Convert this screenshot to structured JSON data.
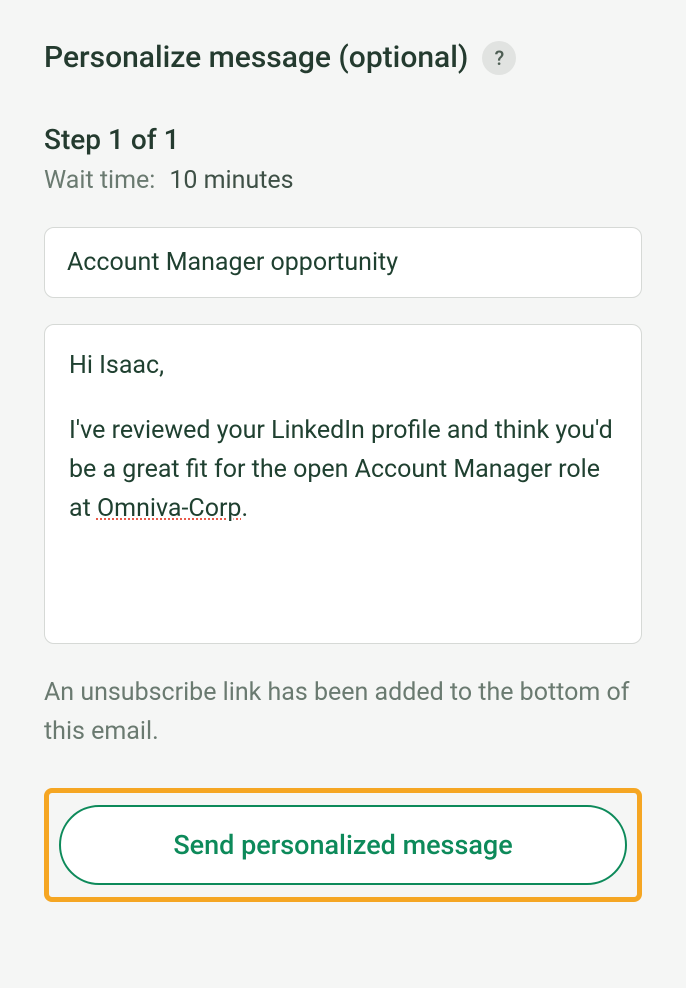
{
  "header": {
    "title": "Personalize message (optional)",
    "help_icon": "?"
  },
  "step": {
    "label": "Step 1 of 1",
    "wait_label": "Wait time:",
    "wait_value": "10 minutes"
  },
  "subject": {
    "value": "Account Manager opportunity"
  },
  "message": {
    "greeting": "Hi Isaac,",
    "body_before": "I've reviewed your LinkedIn profile and think you'd be a great fit for the open Account Manager role at ",
    "body_spellcheck": "Omniva-Corp",
    "body_after": "."
  },
  "footer_note": "An unsubscribe link has been added to the bottom of this email.",
  "send_button_label": "Send personalized message"
}
